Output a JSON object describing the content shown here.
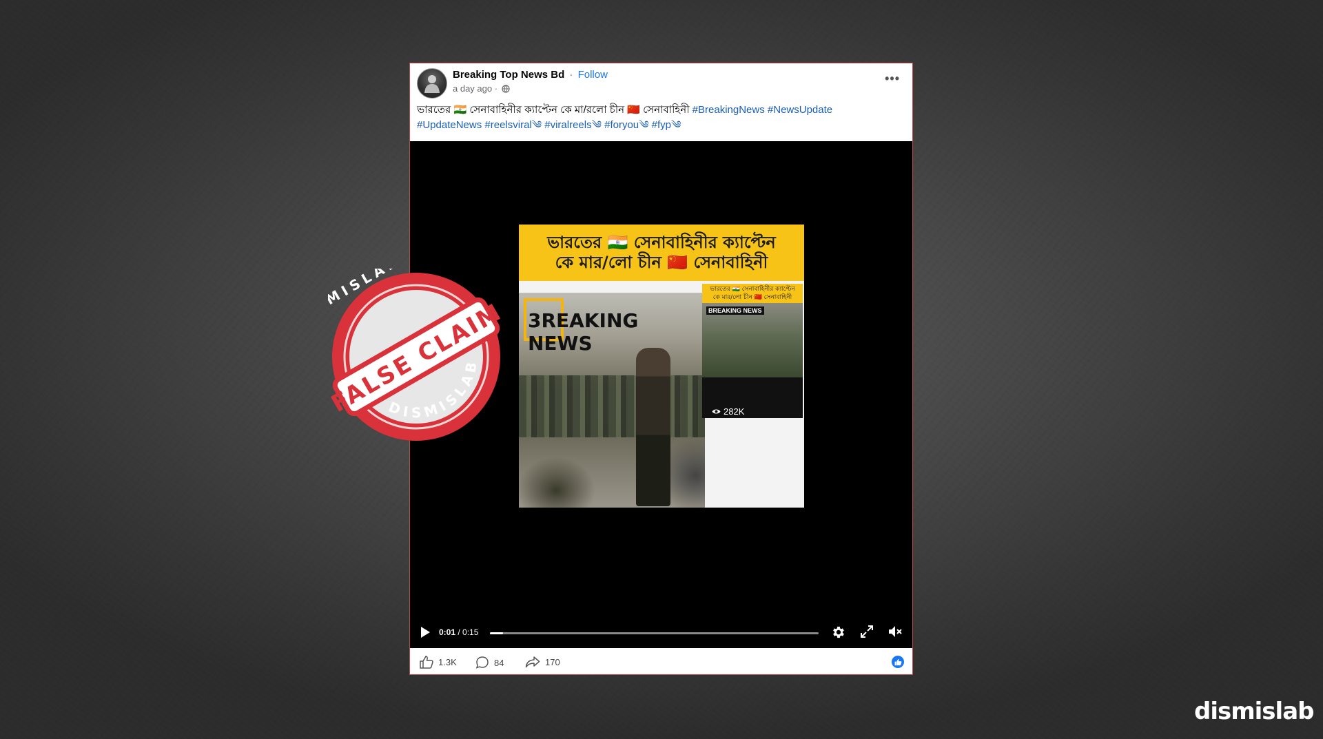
{
  "post": {
    "page_name": "Breaking Top News Bd",
    "separator": "·",
    "follow_label": "Follow",
    "timestamp": "a day ago ·",
    "more_label": "•••",
    "caption_text": "ভারতের 🇮🇳 সেনাবাহিনীর ক্যাপ্টেন কে মা/রলো চীন 🇨🇳 সেনাবাহিনী",
    "hashtags_line1": [
      "#BreakingNews",
      "#NewsUpdate"
    ],
    "hashtags_line2": [
      "#UpdateNews",
      "#reelsviral༄",
      "#viralreels༄",
      "#foryou༄",
      "#fyp༄"
    ]
  },
  "video": {
    "banner_line1": "ভারতের 🇮🇳 সেনাবাহিনীর ক্যাপ্টেন",
    "banner_line2": "কে মার/লো  চীন 🇨🇳 সেনাবাহিনী",
    "breaking_news_text": "3REAKING NEWS",
    "inset_banner_line1": "ভারতের 🇮🇳 সেনাবাহিনীর ক্যাপ্টেন",
    "inset_banner_line2": "কে মার/লো চীন 🇨🇳 সেনাবাহিনী",
    "inset_breaking_label": "BREAKING NEWS",
    "inset_views": "282K",
    "current_time": "0:01",
    "duration": "/ 0:15",
    "progress": 0.04
  },
  "footer": {
    "likes": "1.3K",
    "comments": "84",
    "shares": "170"
  },
  "stamp": {
    "top_text": "DISMISLAB",
    "bottom_text": "DISMISLAB",
    "label": "FALSE CLAIM"
  },
  "brand": "dismislab",
  "colors": {
    "accent_link": "#1877f2",
    "hashtag": "#1a5fb4",
    "banner_yellow": "#f6c316",
    "stamp_red": "#d9323a"
  }
}
